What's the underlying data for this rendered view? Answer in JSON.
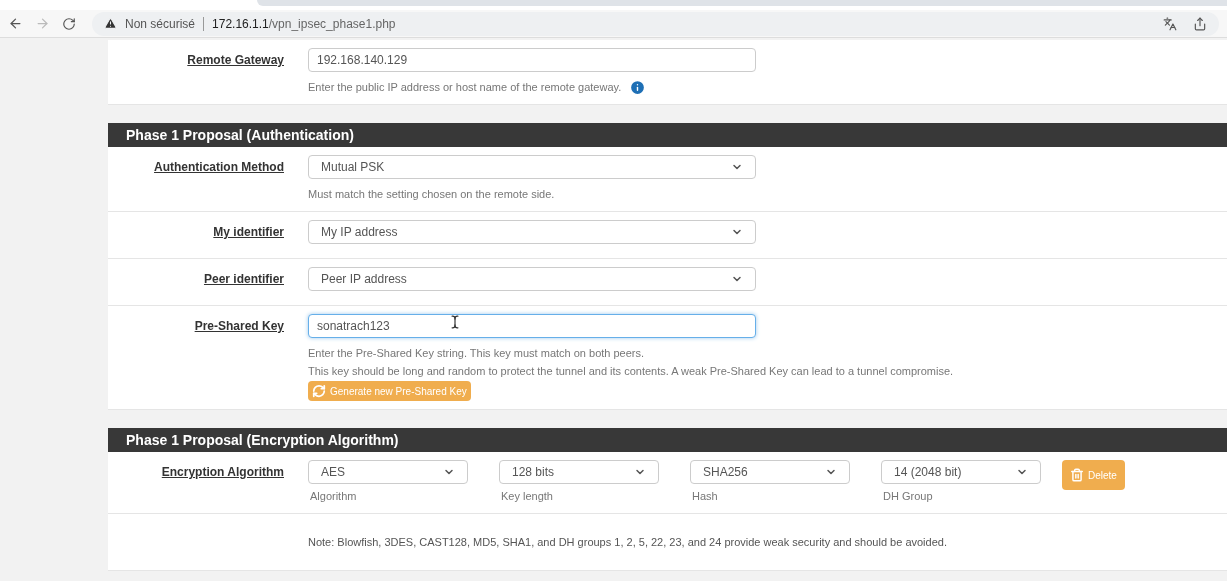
{
  "browser": {
    "security_label": "Non sécurisé",
    "url_host": "172.16.1.1",
    "url_path": "/vpn_ipsec_phase1.php"
  },
  "top_rows": [
    {
      "kind": "input",
      "label": "Remote Gateway",
      "value": "192.168.140.129",
      "help": [
        "Enter the public IP address or host name of the remote gateway."
      ],
      "info": true
    }
  ],
  "sections": [
    {
      "title": "Phase 1 Proposal (Authentication)",
      "rows": [
        {
          "kind": "select",
          "label": "Authentication Method",
          "value": "Mutual PSK",
          "help": [
            "Must match the setting chosen on the remote side."
          ]
        },
        {
          "kind": "select",
          "label": "My identifier",
          "value": "My IP address"
        },
        {
          "kind": "select",
          "label": "Peer identifier",
          "value": "Peer IP address"
        },
        {
          "kind": "input",
          "label": "Pre-Shared Key",
          "value": "sonatrach123",
          "focused": true,
          "help": [
            "Enter the Pre-Shared Key string. This key must match on both peers.",
            "This key should be long and random to protect the tunnel and its contents. A weak Pre-Shared Key can lead to a tunnel compromise."
          ],
          "button": "Generate new Pre-Shared Key"
        }
      ]
    },
    {
      "title": "Phase 1 Proposal (Encryption Algorithm)",
      "rows": [
        {
          "kind": "algo",
          "label": "Encryption Algorithm",
          "selects": [
            {
              "value": "AES",
              "caption": "Algorithm"
            },
            {
              "value": "128 bits",
              "caption": "Key length"
            },
            {
              "value": "SHA256",
              "caption": "Hash"
            },
            {
              "value": "14 (2048 bit)",
              "caption": "DH Group"
            }
          ],
          "button": "Delete"
        },
        {
          "kind": "note",
          "text": "Note: Blowfish, 3DES, CAST128, MD5, SHA1, and DH groups 1, 2, 5, 22, 23, and 24 provide weak security and should be avoided."
        }
      ]
    }
  ]
}
